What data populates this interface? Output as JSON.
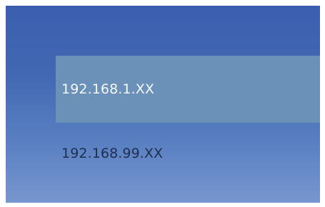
{
  "ip_list": {
    "items": [
      {
        "label": "192.168.1.XX",
        "selected": true
      },
      {
        "label": "192.168.99.XX",
        "selected": false
      }
    ]
  },
  "colors": {
    "background_top": "#3b5fae",
    "background_bottom": "#7896cf",
    "selected_row": "#6b91b9",
    "selected_text": "#f4f7fb",
    "unselected_text": "#1e2f4f"
  }
}
